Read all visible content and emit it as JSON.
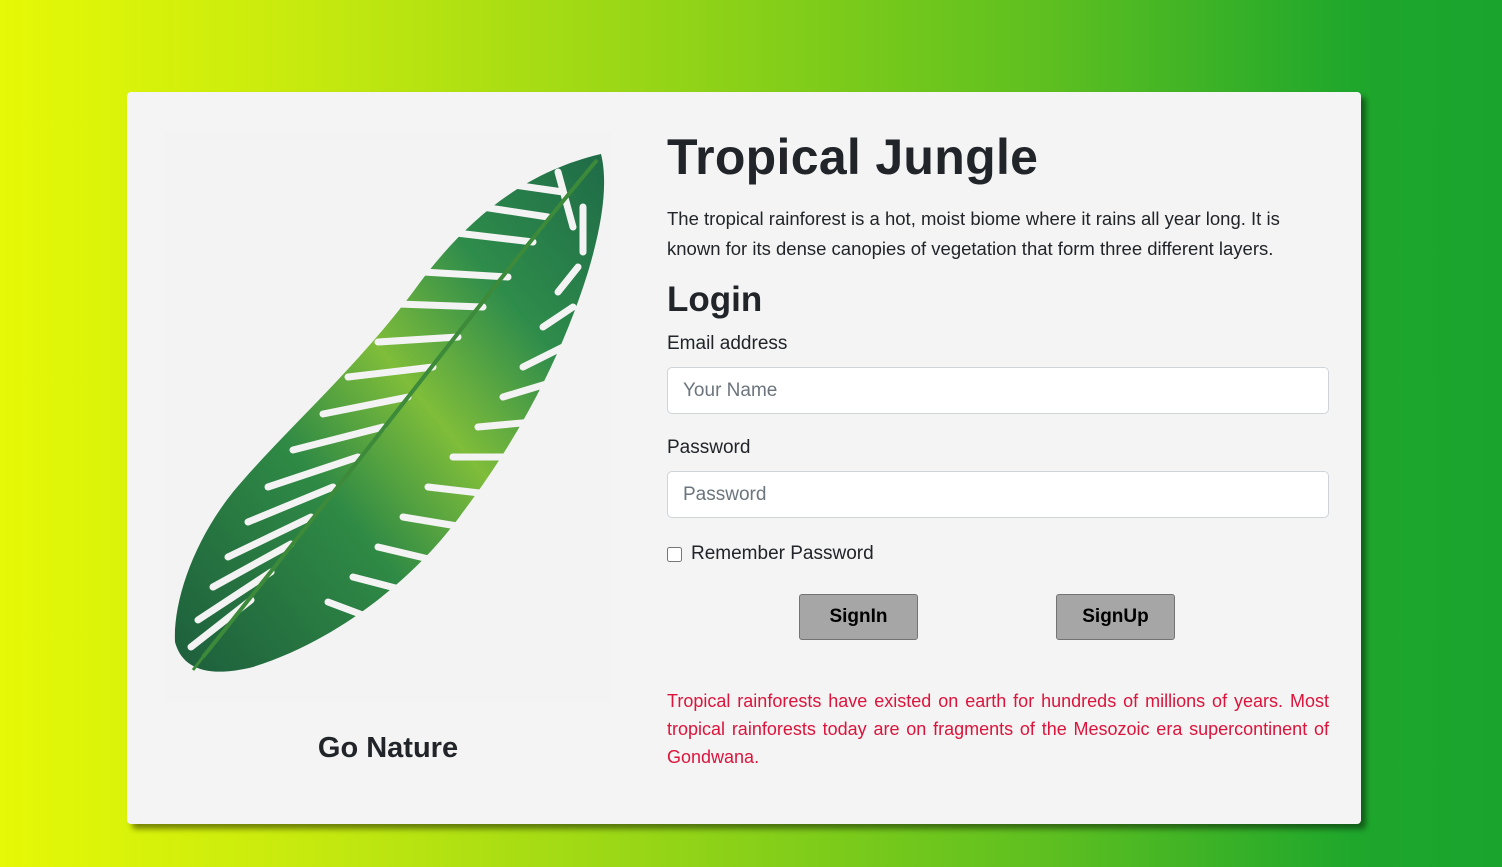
{
  "colors": {
    "background_start": "#e6f906",
    "background_end": "#1aa42e",
    "card": "#f4f4f4",
    "fact_text": "#dc143c",
    "button": "#a6a6a6"
  },
  "left": {
    "image_icon": "palm-leaf-icon",
    "caption": "Go Nature"
  },
  "main": {
    "title": "Tropical Jungle",
    "intro": "The tropical rainforest is a hot, moist biome where it rains all year long. It is known for its dense canopies of vegetation that form three different layers.",
    "login_heading": "Login",
    "email": {
      "label": "Email address",
      "placeholder": "Your Name",
      "value": ""
    },
    "password": {
      "label": "Password",
      "placeholder": "Password",
      "value": ""
    },
    "remember": {
      "label": "Remember Password",
      "checked": false
    },
    "buttons": {
      "signin": "SignIn",
      "signup": "SignUp"
    },
    "fact": "Tropical rainforests have existed on earth for hundreds of millions of years. Most tropical rainforests today are on fragments of the Mesozoic era supercontinent of Gondwana."
  }
}
